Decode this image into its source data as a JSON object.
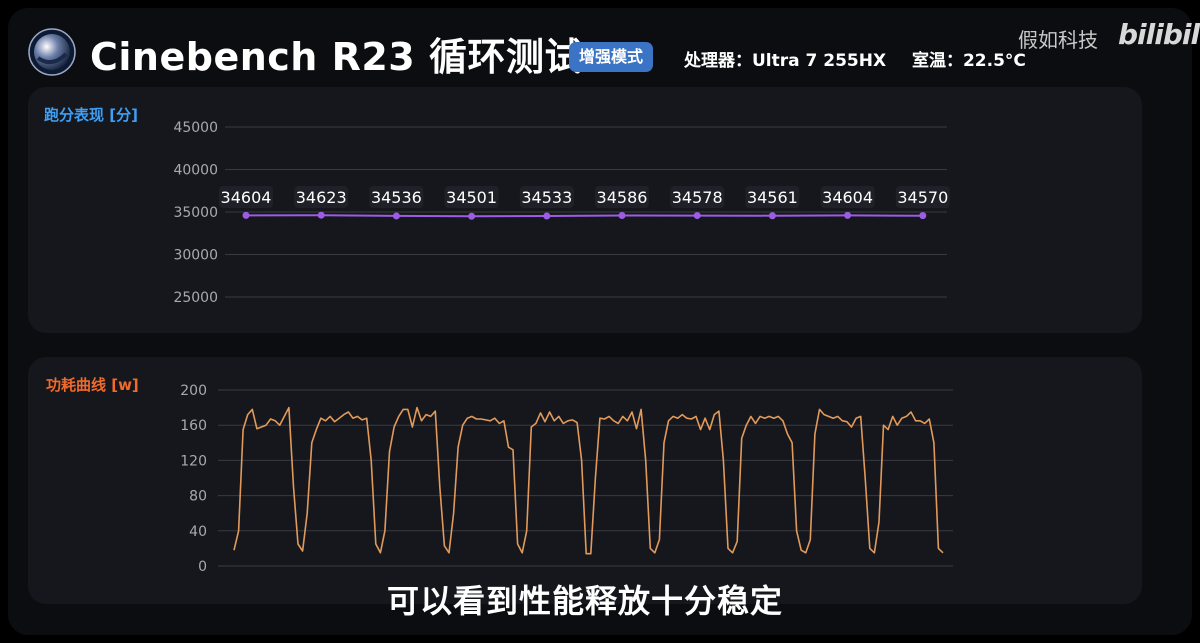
{
  "header": {
    "title": "Cinebench R23 循环测试",
    "mode_badge": "增强模式",
    "cpu_label": "处理器：Ultra 7 255HX",
    "temp_label": "室温：22.5°C",
    "watermark_text": "假如科技",
    "watermark_logo": "bilibili"
  },
  "subtitle": "可以看到性能释放十分稳定",
  "chart_data": [
    {
      "type": "line",
      "title": "跑分表现 [分]",
      "ylim": [
        22500,
        47500
      ],
      "yticks": [
        25000,
        30000,
        35000,
        40000,
        45000
      ],
      "grid": true,
      "colors": {
        "title": "#3d9ff5",
        "line": "#9d5ce6",
        "label_bg": "#202128"
      },
      "series": [
        {
          "values": [
            34604,
            34623,
            34536,
            34501,
            34533,
            34586,
            34578,
            34561,
            34604,
            34570
          ]
        }
      ]
    },
    {
      "type": "line",
      "title": "功耗曲线 [w]",
      "ylim": [
        0,
        200
      ],
      "yticks": [
        0,
        40,
        80,
        120,
        160,
        200
      ],
      "grid": true,
      "colors": {
        "title": "#f06a2c",
        "line": "#e19a5b"
      },
      "series": [
        {
          "values": [
            18,
            40,
            155,
            172,
            178,
            156,
            158,
            160,
            167,
            165,
            160,
            170,
            180,
            90,
            25,
            17,
            60,
            140,
            155,
            168,
            165,
            170,
            164,
            168,
            172,
            175,
            168,
            170,
            166,
            168,
            120,
            25,
            15,
            40,
            130,
            158,
            170,
            178,
            178,
            158,
            180,
            165,
            172,
            170,
            176,
            90,
            23,
            15,
            60,
            135,
            160,
            168,
            170,
            167,
            167,
            166,
            165,
            168,
            162,
            165,
            135,
            132,
            25,
            15,
            40,
            158,
            162,
            174,
            164,
            175,
            165,
            170,
            162,
            165,
            166,
            163,
            120,
            14,
            14,
            100,
            168,
            167,
            170,
            165,
            162,
            170,
            165,
            175,
            156,
            178,
            120,
            20,
            15,
            30,
            140,
            165,
            170,
            168,
            172,
            168,
            167,
            170,
            155,
            168,
            155,
            172,
            176,
            120,
            20,
            15,
            28,
            145,
            160,
            170,
            162,
            170,
            168,
            170,
            168,
            170,
            165,
            150,
            140,
            40,
            18,
            15,
            30,
            150,
            178,
            172,
            170,
            168,
            170,
            165,
            164,
            158,
            168,
            170,
            100,
            20,
            15,
            50,
            160,
            155,
            170,
            160,
            168,
            170,
            175,
            165,
            165,
            162,
            167,
            140,
            20,
            15
          ]
        }
      ]
    }
  ]
}
